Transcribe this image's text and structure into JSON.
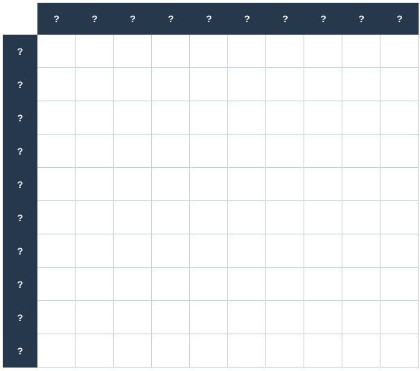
{
  "grid": {
    "header_label": "?",
    "columns": 10,
    "rows": 10,
    "col_headers": [
      "?",
      "?",
      "?",
      "?",
      "?",
      "?",
      "?",
      "?",
      "?",
      "?"
    ],
    "row_headers": [
      "?",
      "?",
      "?",
      "?",
      "?",
      "?",
      "?",
      "?",
      "?",
      "?"
    ],
    "cells": [
      [
        "",
        "",
        "",
        "",
        "",
        "",
        "",
        "",
        "",
        ""
      ],
      [
        "",
        "",
        "",
        "",
        "",
        "",
        "",
        "",
        "",
        ""
      ],
      [
        "",
        "",
        "",
        "",
        "",
        "",
        "",
        "",
        "",
        ""
      ],
      [
        "",
        "",
        "",
        "",
        "",
        "",
        "",
        "",
        "",
        ""
      ],
      [
        "",
        "",
        "",
        "",
        "",
        "",
        "",
        "",
        "",
        ""
      ],
      [
        "",
        "",
        "",
        "",
        "",
        "",
        "",
        "",
        "",
        ""
      ],
      [
        "",
        "",
        "",
        "",
        "",
        "",
        "",
        "",
        "",
        ""
      ],
      [
        "",
        "",
        "",
        "",
        "",
        "",
        "",
        "",
        "",
        ""
      ],
      [
        "",
        "",
        "",
        "",
        "",
        "",
        "",
        "",
        "",
        ""
      ],
      [
        "",
        "",
        "",
        "",
        "",
        "",
        "",
        "",
        "",
        ""
      ]
    ]
  },
  "colors": {
    "header_bg": "#25384c",
    "header_fg": "#ffffff",
    "grid_line": "#c8cdd2",
    "cell_bg": "#ffffff"
  }
}
